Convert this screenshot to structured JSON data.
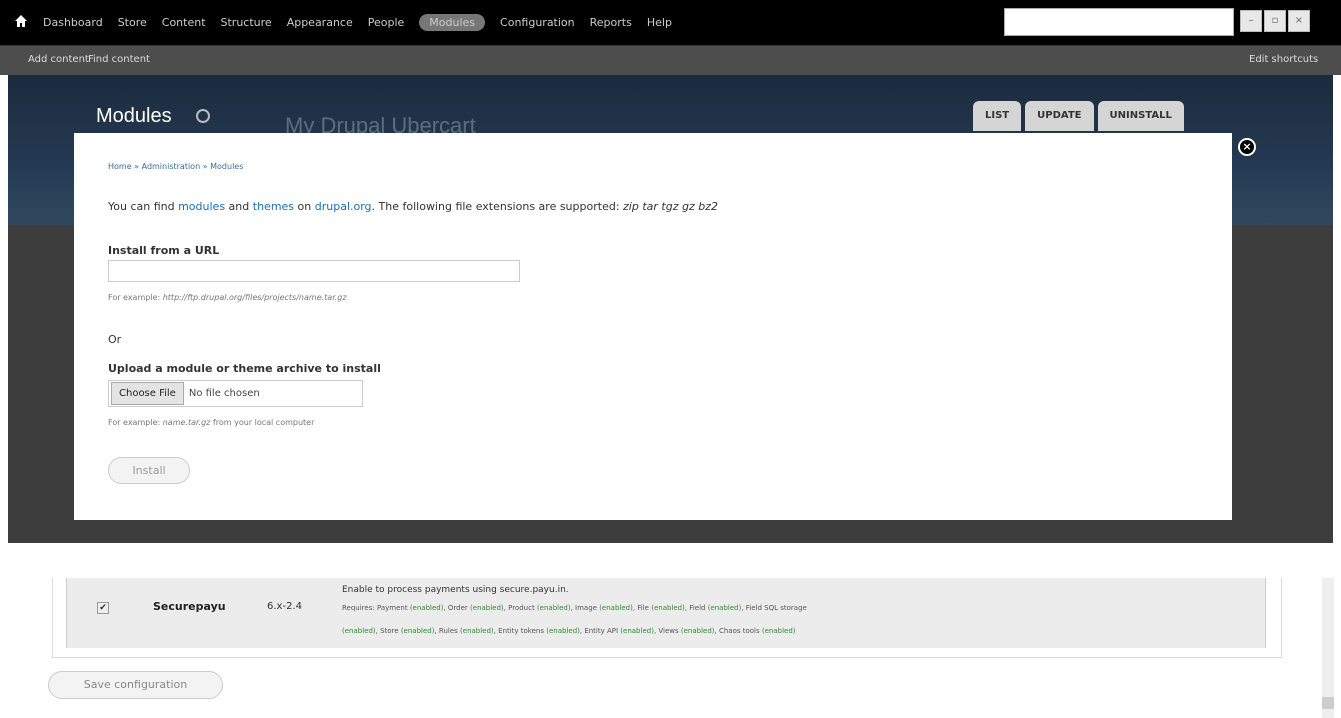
{
  "toolbar": {
    "menu": [
      "Dashboard",
      "Store",
      "Content",
      "Structure",
      "Appearance",
      "People",
      "Modules",
      "Configuration",
      "Reports",
      "Help"
    ],
    "active": "Modules",
    "search_value": ""
  },
  "shortcuts": {
    "add_content": "Add content",
    "find_content": "Find content",
    "edit_shortcuts": "Edit shortcuts"
  },
  "header": {
    "title": "Modules",
    "site_name": "My Drupal Ubercart",
    "tabs": [
      "LIST",
      "UPDATE",
      "UNINSTALL"
    ]
  },
  "modal": {
    "breadcrumb": "Home » Administration » Modules",
    "intro_pre": "You can find ",
    "intro_link1": "modules",
    "intro_and": " and ",
    "intro_link2": "themes",
    "intro_on": " on ",
    "intro_link3": "drupal.org",
    "intro_post": ". The following file extensions are supported: ",
    "extensions": "zip tar tgz gz bz2",
    "url_label": "Install from a URL",
    "url_value": "",
    "url_hint_pre": "For example: ",
    "url_hint_example": "http://ftp.drupal.org/files/projects/name.tar.gz",
    "or": "Or",
    "upload_label": "Upload a module or theme archive to install",
    "choose_file": "Choose File",
    "no_file": "No file chosen",
    "upload_hint_pre": "For example: ",
    "upload_hint_example": "name.tar.gz",
    "upload_hint_post": " from your local computer",
    "install": "Install"
  },
  "module": {
    "checked": true,
    "name": "Securepayu",
    "version": "6.x-2.4",
    "description": "Enable to process payments using secure.payu.in.",
    "requires_line1": [
      {
        "t": "Requires: Payment ",
        "en": false
      },
      {
        "t": "(enabled)",
        "en": true
      },
      {
        "t": ", Order ",
        "en": false
      },
      {
        "t": "(enabled)",
        "en": true
      },
      {
        "t": ", Product ",
        "en": false
      },
      {
        "t": "(enabled)",
        "en": true
      },
      {
        "t": ", Image ",
        "en": false
      },
      {
        "t": "(enabled)",
        "en": true
      },
      {
        "t": ", File ",
        "en": false
      },
      {
        "t": "(enabled)",
        "en": true
      },
      {
        "t": ", Field ",
        "en": false
      },
      {
        "t": "(enabled)",
        "en": true
      },
      {
        "t": ", Field SQL storage",
        "en": false
      }
    ],
    "requires_line2": [
      {
        "t": "(enabled)",
        "en": true
      },
      {
        "t": ", Store ",
        "en": false
      },
      {
        "t": "(enabled)",
        "en": true
      },
      {
        "t": ", Rules ",
        "en": false
      },
      {
        "t": "(enabled)",
        "en": true
      },
      {
        "t": ", Entity tokens ",
        "en": false
      },
      {
        "t": "(enabled)",
        "en": true
      },
      {
        "t": ", Entity API ",
        "en": false
      },
      {
        "t": "(enabled)",
        "en": true
      },
      {
        "t": ", Views ",
        "en": false
      },
      {
        "t": "(enabled)",
        "en": true
      },
      {
        "t": ", Chaos tools ",
        "en": false
      },
      {
        "t": "(enabled)",
        "en": true
      }
    ]
  },
  "save_button": "Save configuration",
  "colors": {
    "link": "#1a6faf",
    "enabled": "#2e8b2e"
  }
}
